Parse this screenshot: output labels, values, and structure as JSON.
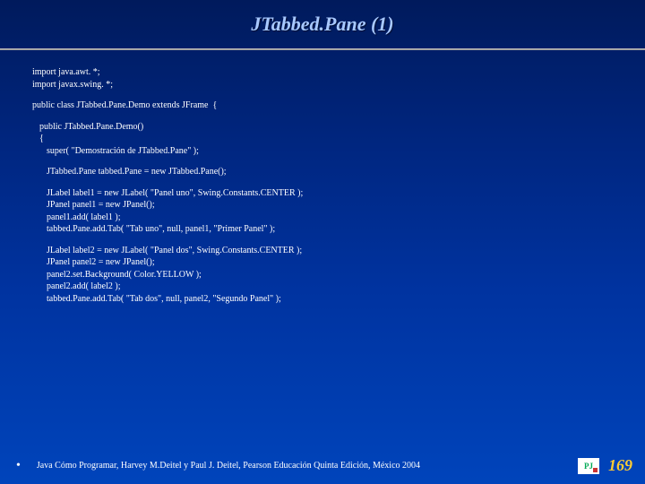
{
  "title": "JTabbed.Pane (1)",
  "code": {
    "l1": "import java.awt. *;",
    "l2": "import javax.swing. *;",
    "l3": "public class JTabbed.Pane.Demo extends JFrame  {",
    "l4": "public JTabbed.Pane.Demo()",
    "l5": "{",
    "l6": "super( \"Demostración de JTabbed.Pane\" );",
    "l7": "JTabbed.Pane tabbed.Pane = new JTabbed.Pane();",
    "l8": "JLabel label1 = new JLabel( \"Panel uno\", Swing.Constants.CENTER );",
    "l9": "JPanel panel1 = new JPanel();",
    "l10": "panel1.add( label1 );",
    "l11": "tabbed.Pane.add.Tab( \"Tab uno\", null, panel1, \"Primer Panel\" );",
    "l12": "JLabel label2 = new JLabel( \"Panel dos\", Swing.Constants.CENTER );",
    "l13": "JPanel panel2 = new JPanel();",
    "l14": "panel2.set.Background( Color.YELLOW );",
    "l15": "panel2.add( label2 );",
    "l16": "tabbed.Pane.add.Tab( \"Tab dos\", null, panel2, \"Segundo Panel\" );"
  },
  "footer": {
    "text": "Java Cómo Programar, Harvey M.Deitel y Paul J. Deitel, Pearson Educación Quinta Edición, México 2004",
    "page": "169",
    "logo_initials": "PJ"
  }
}
